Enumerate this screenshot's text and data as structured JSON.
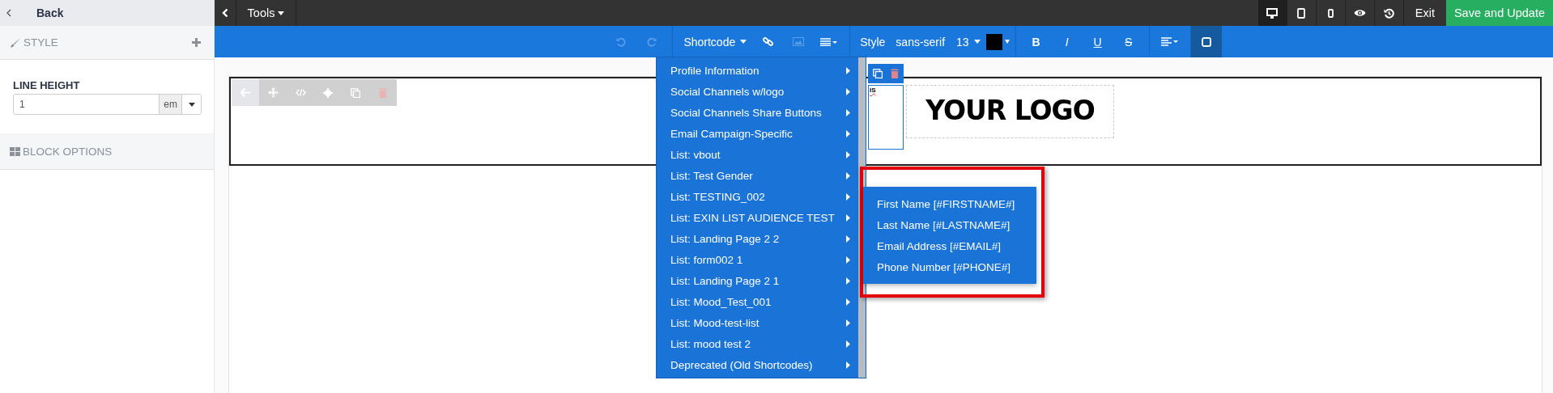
{
  "sidebar": {
    "back": "Back",
    "style_section": {
      "title": "STYLE"
    },
    "line_height": {
      "label": "LINE HEIGHT",
      "value": "1",
      "unit": "em"
    },
    "block_options": {
      "title": "BLOCK OPTIONS"
    }
  },
  "topbar": {
    "tools": "Tools",
    "views": [
      {
        "kind": "desktop",
        "selected": true
      },
      {
        "kind": "tablet",
        "selected": false
      },
      {
        "kind": "phone",
        "selected": false
      }
    ],
    "exit": "Exit",
    "save": "Save and Update"
  },
  "toolbar": {
    "undo": {
      "disabled": true
    },
    "redo": {
      "disabled": true
    },
    "shortcode": "Shortcode",
    "image": {
      "disabled": true
    },
    "style": "Style",
    "font": "sans-serif",
    "size": "13",
    "color": "#000000",
    "formats": [
      "B",
      "I",
      "U",
      "S"
    ],
    "frame_button": {
      "selected": true
    }
  },
  "block_toolbar": [
    {
      "kind": "back",
      "disabled": false
    },
    {
      "kind": "move",
      "disabled": false
    },
    {
      "kind": "code",
      "disabled": false
    },
    {
      "kind": "settings",
      "disabled": false
    },
    {
      "kind": "copy",
      "disabled": false
    },
    {
      "kind": "delete",
      "disabled": true
    }
  ],
  "canvas": {
    "cut_text": "IS",
    "logo": "YOUR LOGO"
  },
  "shortcode_menu": [
    "Profile Information",
    "Social Channels w/logo",
    "Social Channels Share Buttons",
    "Email Campaign-Specific",
    "List: vbout",
    "List: Test Gender",
    "List: TESTING_002",
    "List: EXIN LIST AUDIENCE TEST",
    "List: Landing Page 2 2",
    "List: form002 1",
    "List: Landing Page 2 1",
    "List: Mood_Test_001",
    "List: Mood-test-list",
    "List: mood test 2",
    "Deprecated (Old Shortcodes)"
  ],
  "submenu": [
    "First Name [#FIRSTNAME#]",
    "Last Name [#LASTNAME#]",
    "Email Address [#EMAIL#]",
    "Phone Number [#PHONE#]"
  ]
}
